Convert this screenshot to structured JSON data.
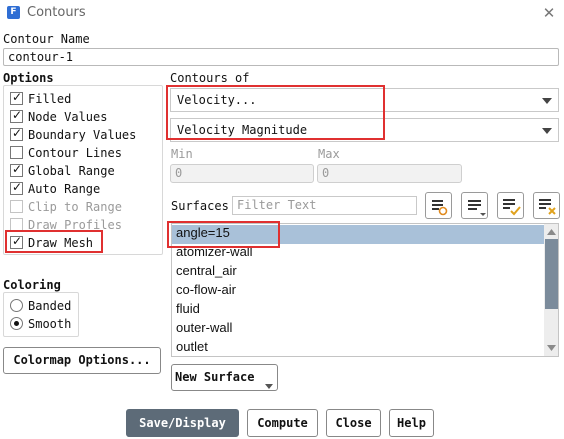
{
  "window": {
    "title": "Contours",
    "app_icon_letter": "F"
  },
  "contour_name": {
    "label": "Contour Name",
    "value": "contour-1"
  },
  "options": {
    "label": "Options",
    "items": [
      {
        "label": "Filled",
        "checked": true,
        "disabled": false
      },
      {
        "label": "Node Values",
        "checked": true,
        "disabled": false
      },
      {
        "label": "Boundary Values",
        "checked": true,
        "disabled": false
      },
      {
        "label": "Contour Lines",
        "checked": false,
        "disabled": false
      },
      {
        "label": "Global Range",
        "checked": true,
        "disabled": false
      },
      {
        "label": "Auto Range",
        "checked": true,
        "disabled": false
      },
      {
        "label": "Clip to Range",
        "checked": false,
        "disabled": true
      },
      {
        "label": "Draw Profiles",
        "checked": false,
        "disabled": true
      },
      {
        "label": "Draw Mesh",
        "checked": true,
        "disabled": false
      }
    ]
  },
  "coloring": {
    "label": "Coloring",
    "options": [
      {
        "label": "Banded",
        "selected": false
      },
      {
        "label": "Smooth",
        "selected": true
      }
    ]
  },
  "colormap_button": "Colormap Options...",
  "contours_of": {
    "label": "Contours of",
    "category": "Velocity...",
    "quantity": "Velocity Magnitude"
  },
  "range": {
    "min_label": "Min",
    "min_value": "0",
    "max_label": "Max",
    "max_value": "0"
  },
  "surfaces": {
    "label": "Surfaces",
    "filter_placeholder": "Filter Text",
    "items": [
      "angle=15",
      "atomizer-wall",
      "central_air",
      "co-flow-air",
      "fluid",
      "outer-wall",
      "outlet"
    ],
    "selected": [
      "angle=15"
    ]
  },
  "new_surface_button": "New Surface",
  "buttons": {
    "save_display": "Save/Display",
    "compute": "Compute",
    "close": "Close",
    "help": "Help"
  },
  "colors": {
    "highlight": "#e03030",
    "list_selection": "#a9c1d9",
    "primary_button": "#5d6b78",
    "app_icon": "#2f6ed4"
  }
}
